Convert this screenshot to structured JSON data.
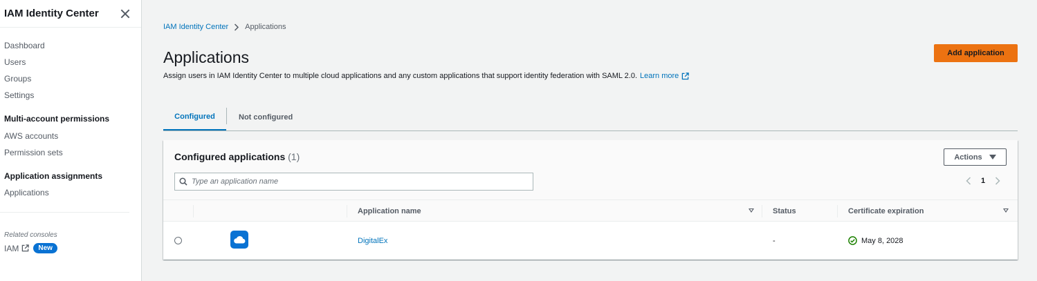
{
  "sidebar": {
    "title": "IAM Identity Center",
    "links": [
      "Dashboard",
      "Users",
      "Groups",
      "Settings"
    ],
    "sections": [
      {
        "title": "Multi-account permissions",
        "links": [
          "AWS accounts",
          "Permission sets"
        ]
      },
      {
        "title": "Application assignments",
        "links": [
          "Applications"
        ]
      }
    ],
    "related_label": "Related consoles",
    "iam_label": "IAM",
    "new_badge": "New"
  },
  "breadcrumb": {
    "parent": "IAM Identity Center",
    "current": "Applications"
  },
  "page": {
    "title": "Applications",
    "description": "Assign users in IAM Identity Center to multiple cloud applications and any custom applications that support identity federation with SAML 2.0.",
    "learn_more": "Learn more",
    "add_button": "Add application"
  },
  "tabs": [
    "Configured",
    "Not configured"
  ],
  "panel": {
    "title": "Configured applications",
    "count": "(1)",
    "actions_label": "Actions",
    "search_placeholder": "Type an application name",
    "page_number": "1",
    "columns": [
      "Application name",
      "Status",
      "Certificate expiration"
    ],
    "rows": [
      {
        "name": "DigitalEx",
        "status": "-",
        "cert_expiration": "May 8, 2028"
      }
    ]
  },
  "colors": {
    "accent": "#0073bb",
    "primary_button": "#ec7211",
    "success": "#1d8102",
    "app_icon_bg": "#0972d3"
  }
}
